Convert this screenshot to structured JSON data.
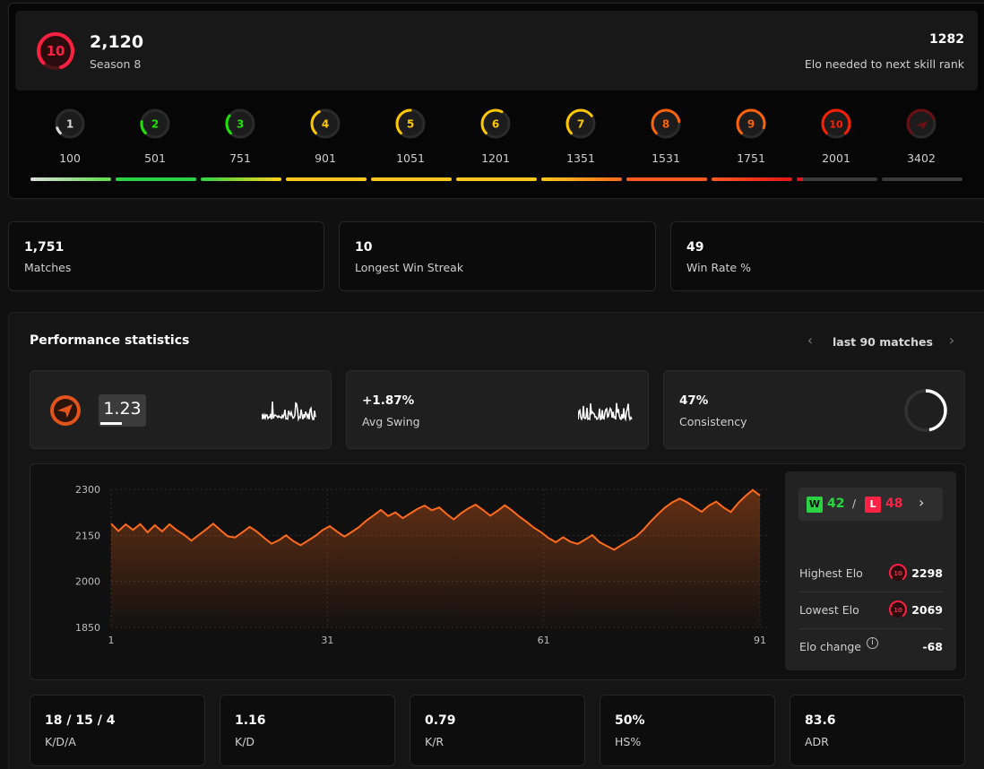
{
  "header": {
    "current_level": "10",
    "elo": "2,120",
    "season": "Season 8",
    "elo_to_next": "1282",
    "elo_to_next_label": "Elo needed to next skill rank"
  },
  "levels": [
    {
      "level": "1",
      "elo": "100",
      "color": "#d8d8d8"
    },
    {
      "level": "2",
      "elo": "501",
      "color": "#1ce400"
    },
    {
      "level": "3",
      "elo": "751",
      "color": "#1ce400"
    },
    {
      "level": "4",
      "elo": "901",
      "color": "#ffc800"
    },
    {
      "level": "5",
      "elo": "1051",
      "color": "#ffc800"
    },
    {
      "level": "6",
      "elo": "1201",
      "color": "#ffc800"
    },
    {
      "level": "7",
      "elo": "1351",
      "color": "#ffc800"
    },
    {
      "level": "8",
      "elo": "1531",
      "color": "#ff6309"
    },
    {
      "level": "9",
      "elo": "1751",
      "color": "#ff6309"
    },
    {
      "level": "10",
      "elo": "2001",
      "color": "#fe1f00"
    },
    {
      "level": "",
      "elo": "3402",
      "color": "#6a0f14"
    }
  ],
  "stats": [
    {
      "value": "1,751",
      "label": "Matches"
    },
    {
      "value": "10",
      "label": "Longest Win Streak"
    },
    {
      "value": "49",
      "label": "Win Rate %"
    }
  ],
  "performance": {
    "title": "Performance statistics",
    "range_label": "last 90 matches",
    "rating": "1.23",
    "avg_swing_value": "+1.87%",
    "avg_swing_label": "Avg Swing",
    "consistency_value": "47%",
    "consistency_label": "Consistency",
    "consistency_fraction": 0.47
  },
  "summary": {
    "wins": "42",
    "losses": "48",
    "win_badge": "W",
    "loss_badge": "L",
    "separator": "/",
    "highest_label": "Highest Elo",
    "highest_value": "2298",
    "highest_level": "10",
    "lowest_label": "Lowest Elo",
    "lowest_value": "2069",
    "lowest_level": "10",
    "change_label": "Elo change",
    "change_value": "-68"
  },
  "bottom_stats": [
    {
      "value": "18 / 15 / 4",
      "label": "K/D/A"
    },
    {
      "value": "1.16",
      "label": "K/D"
    },
    {
      "value": "0.79",
      "label": "K/R"
    },
    {
      "value": "50%",
      "label": "HS%"
    },
    {
      "value": "83.6",
      "label": "ADR"
    }
  ],
  "chart_data": {
    "type": "area",
    "x_ticks": [
      1,
      31,
      61,
      91
    ],
    "y_ticks": [
      1850,
      2000,
      2150,
      2300
    ],
    "ylim": [
      1850,
      2300
    ],
    "xlim": [
      1,
      91
    ],
    "color": "#ff6a1a",
    "series": [
      {
        "values": [
          2188,
          2164,
          2186,
          2168,
          2187,
          2160,
          2183,
          2163,
          2186,
          2167,
          2152,
          2133,
          2151,
          2169,
          2188,
          2167,
          2147,
          2143,
          2160,
          2178,
          2162,
          2142,
          2123,
          2134,
          2150,
          2131,
          2118,
          2133,
          2148,
          2167,
          2180,
          2162,
          2146,
          2161,
          2177,
          2198,
          2215,
          2233,
          2213,
          2225,
          2206,
          2221,
          2236,
          2247,
          2232,
          2241,
          2220,
          2202,
          2222,
          2238,
          2250,
          2233,
          2214,
          2230,
          2248,
          2231,
          2211,
          2194,
          2175,
          2160,
          2141,
          2128,
          2144,
          2129,
          2122,
          2136,
          2151,
          2128,
          2115,
          2103,
          2118,
          2133,
          2146,
          2168,
          2195,
          2219,
          2241,
          2258,
          2270,
          2258,
          2242,
          2227,
          2247,
          2260,
          2241,
          2226,
          2255,
          2278,
          2298,
          2280
        ]
      }
    ]
  }
}
